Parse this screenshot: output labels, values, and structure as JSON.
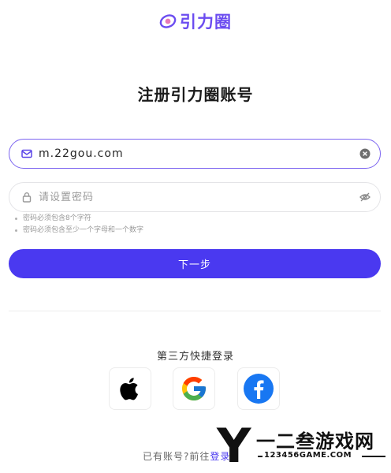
{
  "brand": {
    "name": "引力圈",
    "color": "#6b4cf0"
  },
  "page_title": "注册引力圈账号",
  "email_field": {
    "value": "m.22gou.com",
    "icon": "mail-icon",
    "clear_icon": "clear-icon"
  },
  "password_field": {
    "placeholder": "请设置密码",
    "icon": "lock-icon",
    "toggle_icon": "eye-off-icon"
  },
  "password_rules": [
    "密码必须包含8个字符",
    "密码必须包含至少一个字母和一个数字"
  ],
  "next_button": {
    "label": "下一步",
    "color": "#4a39f0"
  },
  "social_login": {
    "label": "第三方快捷登录",
    "providers": [
      "apple-icon",
      "google-icon",
      "facebook-icon"
    ]
  },
  "login_prompt": {
    "text": "已有账号?前往",
    "link": "登录"
  },
  "watermark": {
    "letter": "Y",
    "text": "一二叁游戏网",
    "url": "123456GAME.COM"
  }
}
